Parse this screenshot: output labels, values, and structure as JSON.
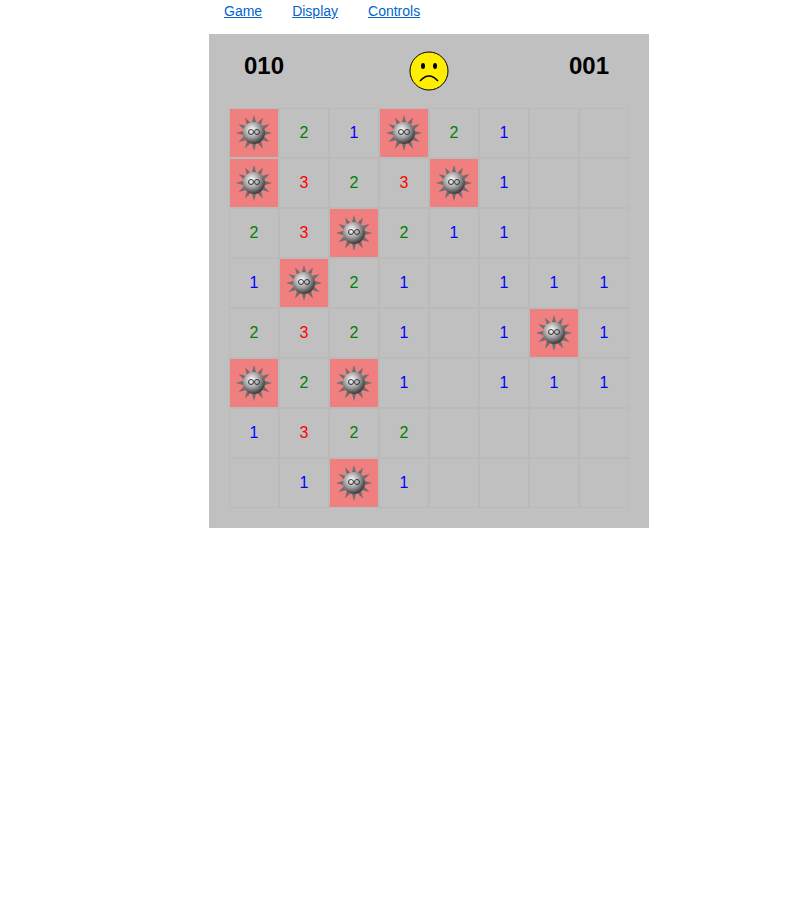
{
  "menu": [
    {
      "label": "Game"
    },
    {
      "label": "Display"
    },
    {
      "label": "Controls"
    }
  ],
  "counters": {
    "mines": "010",
    "time": "001"
  },
  "face": {
    "mood": "sad"
  },
  "grid": {
    "rows": [
      [
        {
          "kind": "mine",
          "text": "",
          "color": ""
        },
        {
          "kind": "number",
          "text": "2",
          "color": "#008000"
        },
        {
          "kind": "number",
          "text": "1",
          "color": "#0000ff"
        },
        {
          "kind": "mine",
          "text": "",
          "color": ""
        },
        {
          "kind": "number",
          "text": "2",
          "color": "#008000"
        },
        {
          "kind": "number",
          "text": "1",
          "color": "#0000ff"
        },
        {
          "kind": "empty",
          "text": "",
          "color": ""
        },
        {
          "kind": "empty",
          "text": "",
          "color": ""
        }
      ],
      [
        {
          "kind": "mine",
          "text": "",
          "color": ""
        },
        {
          "kind": "number",
          "text": "3",
          "color": "#ff0000"
        },
        {
          "kind": "number",
          "text": "2",
          "color": "#008000"
        },
        {
          "kind": "number",
          "text": "3",
          "color": "#ff0000"
        },
        {
          "kind": "mine",
          "text": "",
          "color": ""
        },
        {
          "kind": "number",
          "text": "1",
          "color": "#0000ff"
        },
        {
          "kind": "empty",
          "text": "",
          "color": ""
        },
        {
          "kind": "empty",
          "text": "",
          "color": ""
        }
      ],
      [
        {
          "kind": "number",
          "text": "2",
          "color": "#008000"
        },
        {
          "kind": "number",
          "text": "3",
          "color": "#ff0000"
        },
        {
          "kind": "mine",
          "text": "",
          "color": ""
        },
        {
          "kind": "number",
          "text": "2",
          "color": "#008000"
        },
        {
          "kind": "number",
          "text": "1",
          "color": "#0000ff"
        },
        {
          "kind": "number",
          "text": "1",
          "color": "#0000ff"
        },
        {
          "kind": "empty",
          "text": "",
          "color": ""
        },
        {
          "kind": "empty",
          "text": "",
          "color": ""
        }
      ],
      [
        {
          "kind": "number",
          "text": "1",
          "color": "#0000ff"
        },
        {
          "kind": "mine",
          "text": "",
          "color": ""
        },
        {
          "kind": "number",
          "text": "2",
          "color": "#008000"
        },
        {
          "kind": "number",
          "text": "1",
          "color": "#0000ff"
        },
        {
          "kind": "empty",
          "text": "",
          "color": ""
        },
        {
          "kind": "number",
          "text": "1",
          "color": "#0000ff"
        },
        {
          "kind": "number",
          "text": "1",
          "color": "#0000ff"
        },
        {
          "kind": "number",
          "text": "1",
          "color": "#0000ff"
        }
      ],
      [
        {
          "kind": "number",
          "text": "2",
          "color": "#008000"
        },
        {
          "kind": "number",
          "text": "3",
          "color": "#ff0000"
        },
        {
          "kind": "number",
          "text": "2",
          "color": "#008000"
        },
        {
          "kind": "number",
          "text": "1",
          "color": "#0000ff"
        },
        {
          "kind": "empty",
          "text": "",
          "color": ""
        },
        {
          "kind": "number",
          "text": "1",
          "color": "#0000ff"
        },
        {
          "kind": "mine",
          "text": "",
          "color": ""
        },
        {
          "kind": "number",
          "text": "1",
          "color": "#0000ff"
        }
      ],
      [
        {
          "kind": "mine",
          "text": "",
          "color": ""
        },
        {
          "kind": "number",
          "text": "2",
          "color": "#008000"
        },
        {
          "kind": "mine",
          "text": "",
          "color": ""
        },
        {
          "kind": "number",
          "text": "1",
          "color": "#0000ff"
        },
        {
          "kind": "empty",
          "text": "",
          "color": ""
        },
        {
          "kind": "number",
          "text": "1",
          "color": "#0000ff"
        },
        {
          "kind": "number",
          "text": "1",
          "color": "#0000ff"
        },
        {
          "kind": "number",
          "text": "1",
          "color": "#0000ff"
        }
      ],
      [
        {
          "kind": "number",
          "text": "1",
          "color": "#0000ff"
        },
        {
          "kind": "number",
          "text": "3",
          "color": "#ff0000"
        },
        {
          "kind": "number",
          "text": "2",
          "color": "#008000"
        },
        {
          "kind": "number",
          "text": "2",
          "color": "#008000"
        },
        {
          "kind": "empty",
          "text": "",
          "color": ""
        },
        {
          "kind": "empty",
          "text": "",
          "color": ""
        },
        {
          "kind": "empty",
          "text": "",
          "color": ""
        },
        {
          "kind": "empty",
          "text": "",
          "color": ""
        }
      ],
      [
        {
          "kind": "empty",
          "text": "",
          "color": ""
        },
        {
          "kind": "number",
          "text": "1",
          "color": "#0000ff"
        },
        {
          "kind": "mine",
          "text": "",
          "color": ""
        },
        {
          "kind": "number",
          "text": "1",
          "color": "#0000ff"
        },
        {
          "kind": "empty",
          "text": "",
          "color": ""
        },
        {
          "kind": "empty",
          "text": "",
          "color": ""
        },
        {
          "kind": "empty",
          "text": "",
          "color": ""
        },
        {
          "kind": "empty",
          "text": "",
          "color": ""
        }
      ]
    ]
  }
}
